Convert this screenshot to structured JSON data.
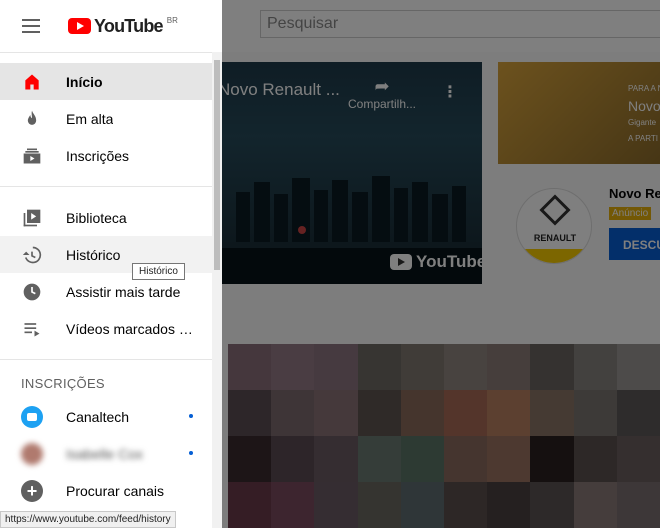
{
  "header": {
    "logo_text": "YouTube",
    "logo_country": "BR",
    "search_placeholder": "Pesquisar"
  },
  "nav_primary": [
    {
      "label": "Início",
      "icon": "home-icon",
      "active": true
    },
    {
      "label": "Em alta",
      "icon": "fire-icon"
    },
    {
      "label": "Inscrições",
      "icon": "subscriptions-icon"
    }
  ],
  "nav_library": [
    {
      "label": "Biblioteca",
      "icon": "library-icon"
    },
    {
      "label": "Histórico",
      "icon": "history-icon",
      "hover": true
    },
    {
      "label": "Assistir mais tarde",
      "icon": "clock-icon"
    },
    {
      "label": "Vídeos marcados co...",
      "icon": "playlist-icon"
    }
  ],
  "subscriptions": {
    "title": "INSCRIÇÕES",
    "items": [
      {
        "label": "Canaltech",
        "icon": "canaltech-avatar",
        "new": true
      },
      {
        "label": "Isabelle Cox",
        "icon": "user-avatar",
        "new": true,
        "blurred": true
      },
      {
        "label": "Procurar canais",
        "icon": "add-circle-icon"
      }
    ]
  },
  "tooltip": "Histórico",
  "status_url": "https://www.youtube.com/feed/history",
  "background": {
    "video_title": "Novo Renault ...",
    "share_label": "Compartilh...",
    "watermark": "YouTube",
    "ad_line1": "PARA A N",
    "ad_line2": "Novo",
    "ad_line3": "Gigante",
    "ad_line4": "A PARTI",
    "ad_title": "Novo Ren",
    "ad_badge": "Anúncio",
    "ad_button": "DESCU",
    "renault_logo_text": "RENAULT"
  },
  "colors": {
    "brand_red": "#ff0000",
    "accent_blue": "#065fd4",
    "active_bg": "#e5e5e5"
  }
}
